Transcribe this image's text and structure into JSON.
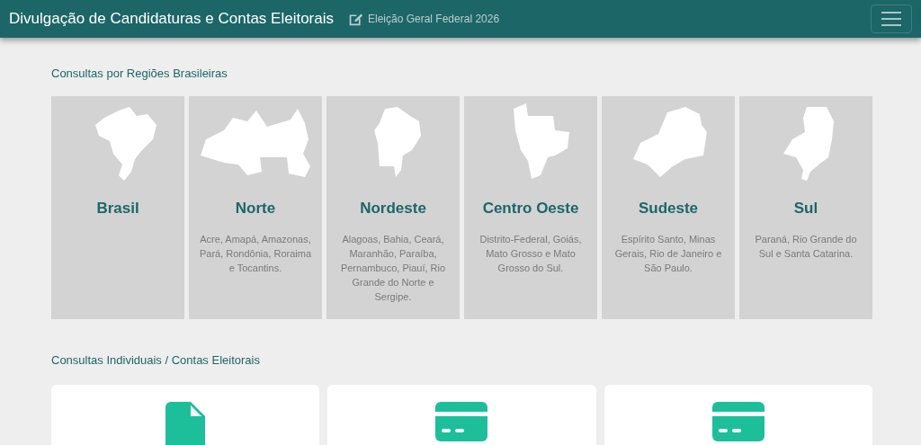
{
  "header": {
    "title": "Divulgação de Candidaturas e Contas Eleitorais",
    "subtitle": "Eleição Geral Federal 2026"
  },
  "regions_section": {
    "heading": "Consultas por Regiões Brasileiras",
    "regions": [
      {
        "name": "Brasil"
      },
      {
        "name": "Norte",
        "states": "Acre, Amapá, Amazonas, Pará, Rondônia, Roraima e Tocantins."
      },
      {
        "name": "Nordeste",
        "states": "Alagoas, Bahia, Ceará, Maranhão, Paraíba, Pernambuco, Piauí, Rio Grande do Norte e Sergipe."
      },
      {
        "name": "Centro Oeste",
        "states": "Distrito-Federal, Goiás, Mato Grosso e Mato Grosso do Sul."
      },
      {
        "name": "Sudeste",
        "states": "Espírito Santo, Minas Gerais, Rio de Janeiro e São Paulo."
      },
      {
        "name": "Sul",
        "states": "Paraná, Rio Grande do Sul e Santa Catarina."
      }
    ]
  },
  "individual_section": {
    "heading": "Consultas Individuais / Contas Eleitorais",
    "cards": [
      {
        "kind": "document"
      },
      {
        "kind": "card"
      },
      {
        "kind": "card"
      }
    ]
  }
}
